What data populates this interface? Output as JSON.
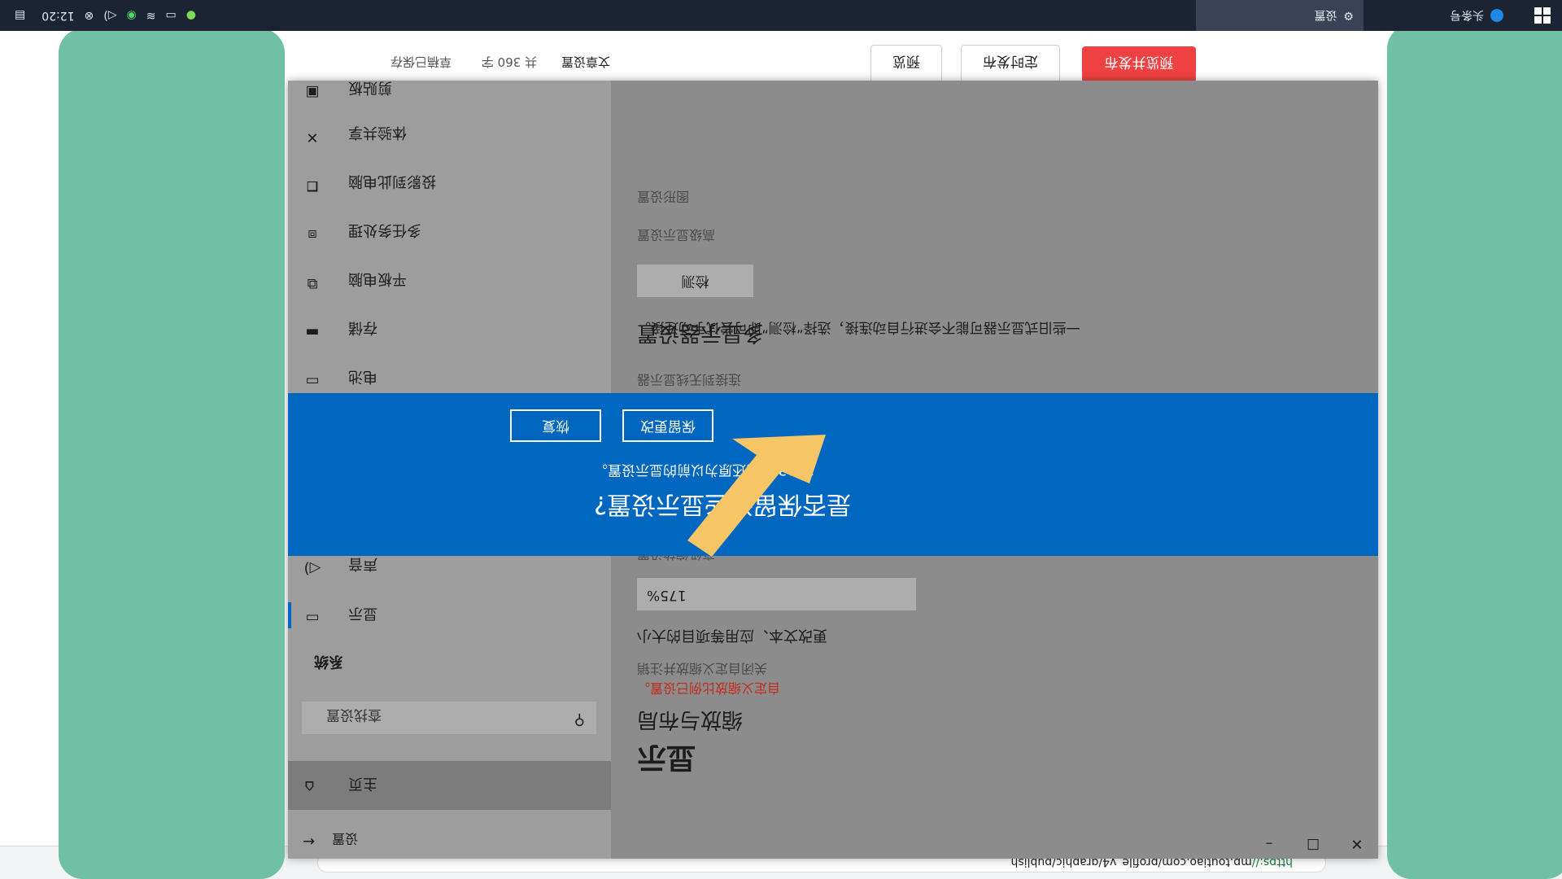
{
  "taskbar": {
    "app1": "头条号",
    "app2": "设置",
    "clock": "12:20"
  },
  "browser": {
    "url_secure": "https://",
    "url_rest": "mp.toutiao.com/profile_v4/graphic/publish"
  },
  "editor": {
    "publish_button": "预览并发布",
    "schedule_button": "定时发布",
    "preview_button": "预览",
    "word_count": "共 360 字",
    "draft_status": "草稿已保存",
    "article_settings": "文章设置"
  },
  "settings": {
    "window_title": "设置",
    "home": "主页",
    "search_placeholder": "查找设置",
    "system_header": "系统",
    "nav": [
      {
        "label": "显示",
        "icon": "monitor-icon"
      },
      {
        "label": "声音",
        "icon": "speaker-icon"
      },
      {
        "label": "电池",
        "icon": "battery-icon"
      },
      {
        "label": "存储",
        "icon": "storage-icon"
      },
      {
        "label": "平板电脑",
        "icon": "tablet-icon"
      },
      {
        "label": "多任务处理",
        "icon": "multitask-icon"
      },
      {
        "label": "投影到此电脑",
        "icon": "project-icon"
      },
      {
        "label": "体验共享",
        "icon": "share-icon"
      },
      {
        "label": "剪贴板",
        "icon": "clipboard-icon"
      }
    ],
    "page_title": "显示",
    "scale_heading": "缩放与布局",
    "custom_scale_warning": "自定义缩放比例已设置。",
    "custom_scale_link": "关闭自定义缩放并注销",
    "text_size_label": "更改文本、应用等项目的大小",
    "scale_value": "175%",
    "advanced_scaling": "高级缩放设置",
    "multi_display_heading": "多显示器设置",
    "connect_wireless": "连接到无线显示器",
    "detect_hint": "一些旧式显示器可能不会进行自动连接，选择“检测”即可尝试手动连接。",
    "detect_button": "检测",
    "advanced_display": "高级显示设置",
    "graphics_settings": "图形设置"
  },
  "dialog": {
    "title": "是否保留这些显示设置?",
    "subtitle": "在 13 秒内还原为以前的显示设置。",
    "keep_button": "保留更改",
    "revert_button": "恢复"
  },
  "colors": {
    "accent_blue": "#0067c0",
    "publish_red": "#f04142",
    "overlay_green": "#70c0a6",
    "arrow_yellow": "#f5c566"
  }
}
